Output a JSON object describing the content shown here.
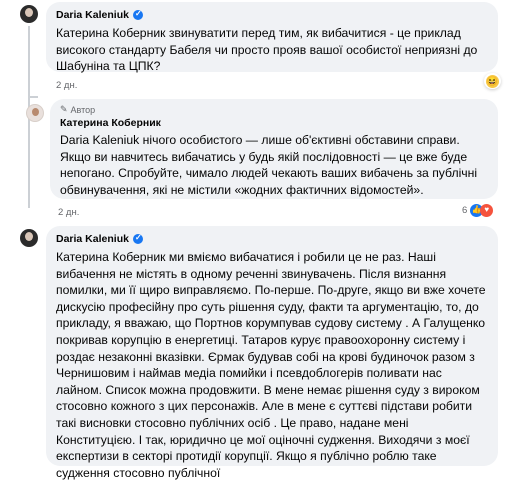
{
  "comments": [
    {
      "author": "Daria Kaleniuk",
      "text": "Катерина Коберник звинуватити перед тим, як вибачитися - це приклад високого стандарту Бабеля чи просто прояв вашої особистої неприязні до Шабуніна та ЦПК?",
      "time": "2 дн.",
      "reactions": [
        "haha-icon"
      ]
    },
    {
      "author_label": "Автор",
      "author": "Катерина Коберник",
      "tag": "Daria Kaleniuk",
      "text": " нічого особистого — лише об'єктивні обставини справи. Якщо ви навчитесь вибачатись у будь якій послідовності — це вже буде непогано. Спробуйте, чимало людей чекають ваших вибачень за публічні обвинувачення, які не містили «жодних фактичних відомостей».",
      "time": "2 дн.",
      "reaction_count": "6",
      "reactions": [
        "like-icon",
        "care-icon"
      ]
    },
    {
      "author": "Daria Kaleniuk",
      "text": "Катерина Коберник ми вміємо вибачатися і робили це не раз. Наші вибачення не містять в одному реченні звинувачень. Після визнання помилки, ми її щиро виправляємо. По-перше. По-друге, якщо ви вже хочете дискусію професійну про суть рішення суду, факти та аргументацію, то, до прикладу, я вважаю, що Портнов корумпував судову систему . А Галущенко покривав корупцію в енергетиці. Татаров курує правоохоронну систему і роздає незаконні вказівки. Єрмак будував собі на крові будиночок разом з Чернишовим і наймав медіа помийки і псевдоблогерів поливати нас лайном. Список можна продовжити. В мене немає рішення суду з вироком стосовно кожного з цих персонажів. Але в мене є суттєві підстави робити такі висновки стосовно публічних осіб . Це право, надане мені Конституцією. І так, юридично це мої оціночні судження. Виходячи з моєї експертизи в секторі протидії корупції. Якщо я публічно роблю таке судження стосовно публічної"
    }
  ]
}
